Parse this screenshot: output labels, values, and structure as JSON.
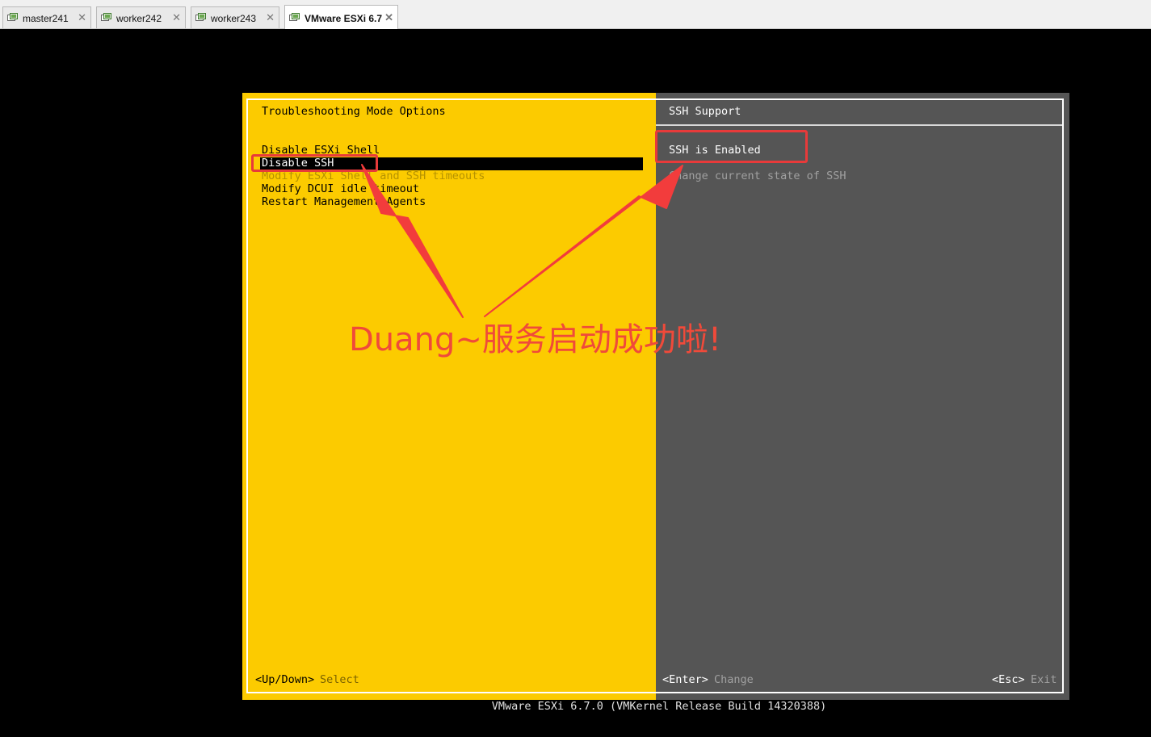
{
  "tabs": [
    {
      "label": "master241",
      "icon": "vm-icon",
      "close": "✕"
    },
    {
      "label": "worker242",
      "icon": "vm-icon",
      "close": "✕"
    },
    {
      "label": "worker243",
      "icon": "vm-icon",
      "close": "✕"
    },
    {
      "label": "VMware ESXi 6.7",
      "icon": "vm-icon",
      "close": "✕",
      "active": true
    }
  ],
  "left": {
    "title": "Troubleshooting Mode Options",
    "items": [
      "Disable ESXi Shell",
      "Disable SSH",
      "Modify ESXi Shell and SSH timeouts",
      "Modify DCUI idle timeout",
      "Restart Management Agents"
    ],
    "selected_index": 1,
    "footer_key": "<Up/Down>",
    "footer_action": "Select"
  },
  "right": {
    "title": "SSH Support",
    "status": "SSH is Enabled",
    "hint": "Change current state of SSH",
    "enter_key": "<Enter>",
    "enter_action": "Change",
    "esc_key": "<Esc>",
    "esc_action": "Exit"
  },
  "status_line": "VMware ESXi 6.7.0 (VMKernel Release Build 14320388)",
  "annotation": {
    "text": "Duang~服务启动成功啦!",
    "color": "#f04a3a"
  },
  "colors": {
    "yellow_pane": "#fccb00",
    "gray_pane": "#555555",
    "annotation_red": "#e83a3a"
  }
}
